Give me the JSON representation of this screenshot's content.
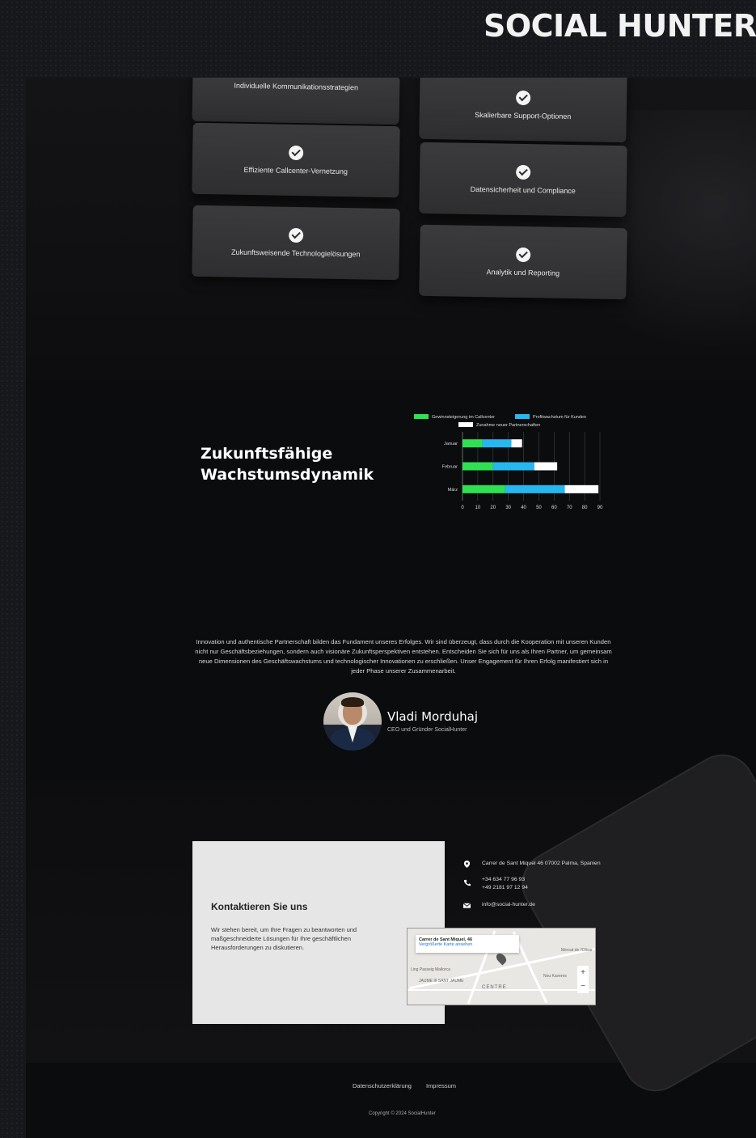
{
  "brand": "SOCIAL HUNTER",
  "features": [
    {
      "label": "Individuelle Kommunikationsstrategien"
    },
    {
      "label": "Skalierbare Support-Optionen"
    },
    {
      "label": "Effiziente Callcenter-Vernetzung"
    },
    {
      "label": "Datensicherheit und Compliance"
    },
    {
      "label": "Zukunftsweisende Technologielösungen"
    },
    {
      "label": "Analytik und Reporting"
    }
  ],
  "growth": {
    "title_line1": "Zukunftsfähige",
    "title_line2": "Wachstumsdynamik"
  },
  "chart_data": {
    "type": "bar",
    "orientation": "horizontal",
    "stacked": true,
    "categories": [
      "Januar",
      "Februar",
      "März"
    ],
    "series": [
      {
        "name": "Gewinnsteigerung im Callcenter",
        "color": "#2ee052",
        "values": [
          13,
          20,
          28
        ]
      },
      {
        "name": "Profitwachstum für Kunden",
        "color": "#27b7f0",
        "values": [
          19,
          27,
          39
        ]
      },
      {
        "name": "Zunahme neuer Partnerschaften",
        "color": "#ffffff",
        "values": [
          7,
          15,
          22
        ]
      }
    ],
    "xticks": [
      "0",
      "10",
      "20",
      "30",
      "40",
      "50",
      "60",
      "70",
      "80",
      "90"
    ],
    "xlim": [
      0,
      90
    ],
    "legend_position": "top",
    "grid": true
  },
  "quote": "Innovation und authentische Partnerschaft bilden das Fundament unseres Erfolges. Wir sind überzeugt, dass durch die Kooperation mit unseren Kunden nicht nur Geschäftsbeziehungen, sondern auch visionäre Zukunftsperspektiven entstehen. Entscheiden Sie sich für uns als Ihren Partner, um gemeinsam neue Dimensionen des Geschäftswachstums und technologischer Innovationen zu erschließen. Unser Engagement für Ihren Erfolg manifestiert sich in jeder Phase unserer Zusammenarbeit.",
  "person": {
    "name": "Vladi Morduhaj",
    "role": "CEO und Gründer SocialHunter"
  },
  "contact": {
    "title": "Kontaktieren Sie uns",
    "text": "Wir stehen bereit, um Ihre Fragen zu beantworten und maßgeschneiderte Lösungen für Ihre geschäftlichen Herausforderungen zu diskutieren.",
    "address": "Carrer de Sant Miquel 46 07002 Palma, Spanien",
    "phone1": "+34 634 77 96 93",
    "phone2": "+49 2181 97 12 94",
    "email": "info@social-hunter.de",
    "map": {
      "card_title": "Carrer de Sant Miquel, 46",
      "card_sub": "Vergrößerte Karte ansehen",
      "label_centre": "CENTRE",
      "label_jaume": "JAUME III SANT JAUME",
      "label_mallorca": "Ling Passeig Mallorca",
      "label_nou": "Nou Kaveres",
      "label_olivar": "Mercat de l'Olivar",
      "zoom_in": "+",
      "zoom_out": "−"
    }
  },
  "footer": {
    "privacy": "Datenschutzerklärung",
    "imprint": "Impressum",
    "copyright": "Copyright © 2024 SocialHunter"
  },
  "colors": {
    "background": "#0b0c0e",
    "card": "#333335",
    "contact_box": "#e6e6e6"
  }
}
